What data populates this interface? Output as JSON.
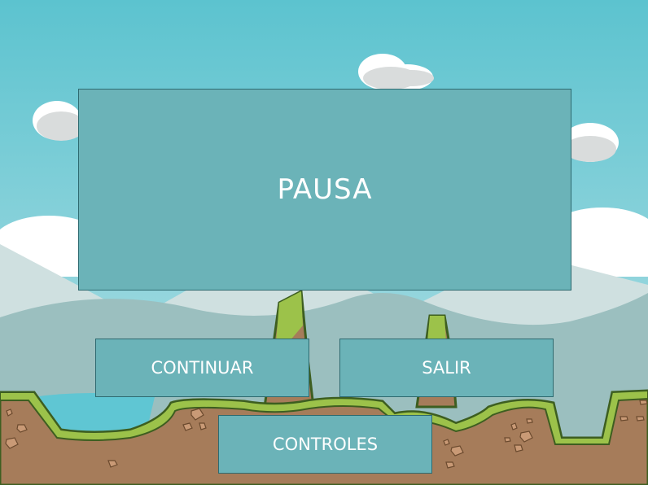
{
  "pause_menu": {
    "title": "PAUSA",
    "buttons": {
      "continue": "CONTINUAR",
      "exit": "SALIR",
      "controls": "CONTROLES"
    }
  },
  "colors": {
    "sky_top": "#5cc3cf",
    "sky_bottom": "#b7e1e6",
    "panel": "#6bb3b8",
    "panel_border": "#2e6a70",
    "text": "#ffffff",
    "grass": "#9cc24a",
    "dirt": "#a67c5a",
    "water": "#5fc6d3"
  }
}
